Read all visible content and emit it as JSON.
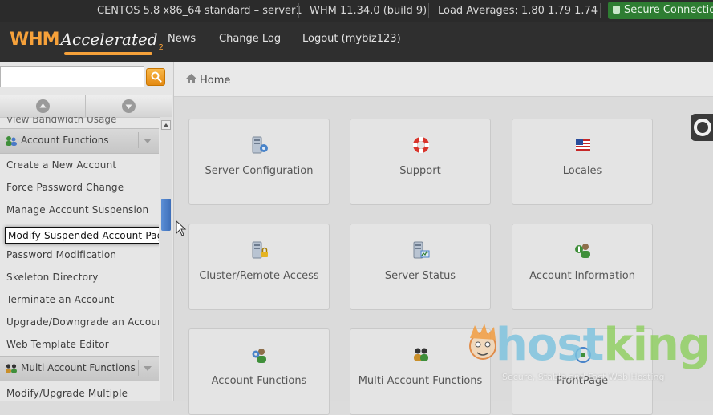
{
  "statusbar": {
    "os": "CENTOS 5.8 x86_64 standard – server1",
    "version": "WHM 11.34.0 (build 9)",
    "load": "Load Averages: 1.80 1.79 1.74",
    "secure": "Secure Connection"
  },
  "header": {
    "logo_main": "WHM",
    "logo_sub": "Accelerated",
    "logo_sup": "2",
    "nav": [
      "News",
      "Change Log",
      "Logout (mybiz123)"
    ]
  },
  "search": {
    "value": "",
    "placeholder": ""
  },
  "sidebar": {
    "cut_label": "View Bandwidth Usage",
    "group1": "Account Functions",
    "items": [
      "Create a New Account",
      "Force Password Change",
      "Manage Account Suspension",
      "Modify Suspended Account Page",
      "Password Modification",
      "Skeleton Directory",
      "Terminate an Account",
      "Upgrade/Downgrade an Account",
      "Web Template Editor"
    ],
    "highlighted_index": 3,
    "group2": "Multi Account Functions",
    "group2_items": [
      "Modify/Upgrade Multiple"
    ]
  },
  "breadcrumb": {
    "label": "Home"
  },
  "tiles": [
    {
      "label": "Server Configuration",
      "icon": "server-config-icon"
    },
    {
      "label": "Support",
      "icon": "lifebuoy-icon"
    },
    {
      "label": "Locales",
      "icon": "flag-icon"
    },
    {
      "label": "Cluster/Remote Access",
      "icon": "server-lock-icon"
    },
    {
      "label": "Server Status",
      "icon": "server-status-icon"
    },
    {
      "label": "Account Information",
      "icon": "user-info-icon"
    },
    {
      "label": "Account Functions",
      "icon": "user-gear-icon"
    },
    {
      "label": "Multi Account Functions",
      "icon": "users-icon"
    },
    {
      "label": "FrontPage",
      "icon": "frontpage-icon"
    }
  ],
  "watermark": {
    "brand_a": "host",
    "brand_b": "king",
    "tagline": "Secure, Stable and Fast Web Hosting"
  },
  "colors": {
    "accent": "#f6a13a",
    "secure_green": "#2e7d32",
    "scroll_thumb": "#4a7fc8"
  }
}
